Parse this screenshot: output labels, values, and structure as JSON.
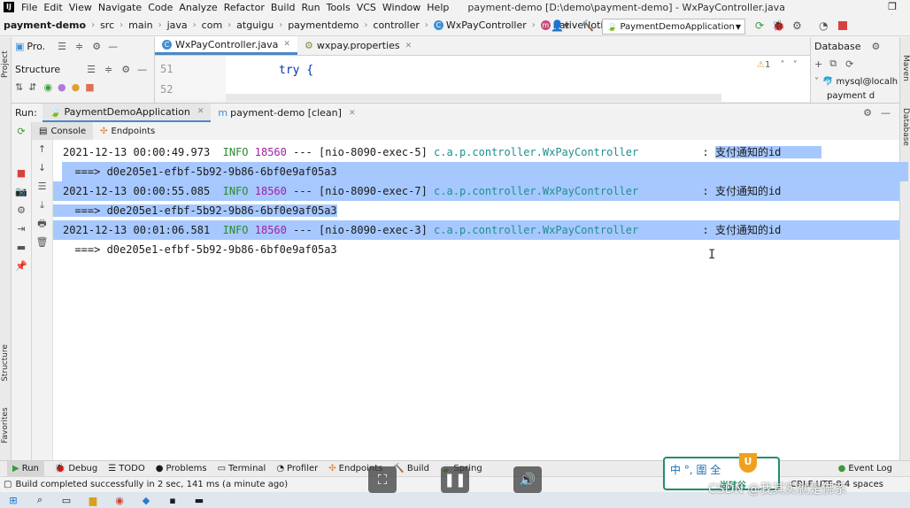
{
  "menu": {
    "items": [
      "File",
      "Edit",
      "View",
      "Navigate",
      "Code",
      "Analyze",
      "Refactor",
      "Build",
      "Run",
      "Tools",
      "VCS",
      "Window",
      "Help"
    ],
    "window_title": "payment-demo [D:\\demo\\payment-demo] - WxPayController.java"
  },
  "nav": {
    "crumbs": [
      "payment-demo",
      "src",
      "main",
      "java",
      "com",
      "atguigu",
      "paymentdemo",
      "controller",
      "WxPayController",
      "nativeNotify"
    ],
    "run_config": "PaymentDemoApplication"
  },
  "project_panel": {
    "tab_label": "Pro.",
    "structure_label": "Structure"
  },
  "editor": {
    "tabs": [
      {
        "label": "WxPayController.java",
        "active": true
      },
      {
        "label": "wxpay.properties",
        "active": false
      }
    ],
    "line_numbers": [
      "51",
      "52"
    ],
    "code": "try {",
    "warning_count": "1"
  },
  "database": {
    "title": "Database",
    "items": [
      "mysql@localh",
      "payment d"
    ]
  },
  "side_labels": {
    "project": "Project",
    "structure": "Structure",
    "favorites": "Favorites",
    "maven": "Maven",
    "database": "Database"
  },
  "run": {
    "label": "Run:",
    "tabs": [
      {
        "label": "PaymentDemoApplication",
        "active": true
      },
      {
        "label": "payment-demo [clean]",
        "active": false
      }
    ],
    "subtabs": [
      {
        "label": "Console",
        "active": true
      },
      {
        "label": "Endpoints",
        "active": false
      }
    ]
  },
  "console": {
    "lines": [
      {
        "ts": "2021-12-13 00:00:49.973",
        "level": "INFO",
        "pid": "18560",
        "thread": "--- [nio-8090-exec-5]",
        "cls": "c.a.p.controller.WxPayController",
        "msg": "支付通知的id",
        "id": "===> d0e205e1-efbf-5b92-9b86-6bf0e9af05a3",
        "selected": true
      },
      {
        "ts": "2021-12-13 00:00:55.085",
        "level": "INFO",
        "pid": "18560",
        "thread": "--- [nio-8090-exec-7]",
        "cls": "c.a.p.controller.WxPayController",
        "msg": "支付通知的id",
        "id": "===> d0e205e1-efbf-5b92-9b86-6bf0e9af05a3",
        "selected": true
      },
      {
        "ts": "2021-12-13 00:01:06.581",
        "level": "INFO",
        "pid": "18560",
        "thread": "--- [nio-8090-exec-3]",
        "cls": "c.a.p.controller.WxPayController",
        "msg": "支付通知的id",
        "id": "===> d0e205e1-efbf-5b92-9b86-6bf0e9af05a3",
        "selected": false
      }
    ]
  },
  "bottom_tools": [
    "Run",
    "Debug",
    "TODO",
    "Problems",
    "Terminal",
    "Profiler",
    "Endpoints",
    "Build",
    "Spring"
  ],
  "event_log": "Event Log",
  "status": {
    "message": "Build completed successfully in 2 sec, 141 ms (a minute ago)",
    "right": "CRLF  UTF-8  4 spaces"
  },
  "ime": {
    "chars": "中 °, 圍 全",
    "brand": "尚硅谷"
  },
  "watermark": "CSDN @我其实就是佛系"
}
